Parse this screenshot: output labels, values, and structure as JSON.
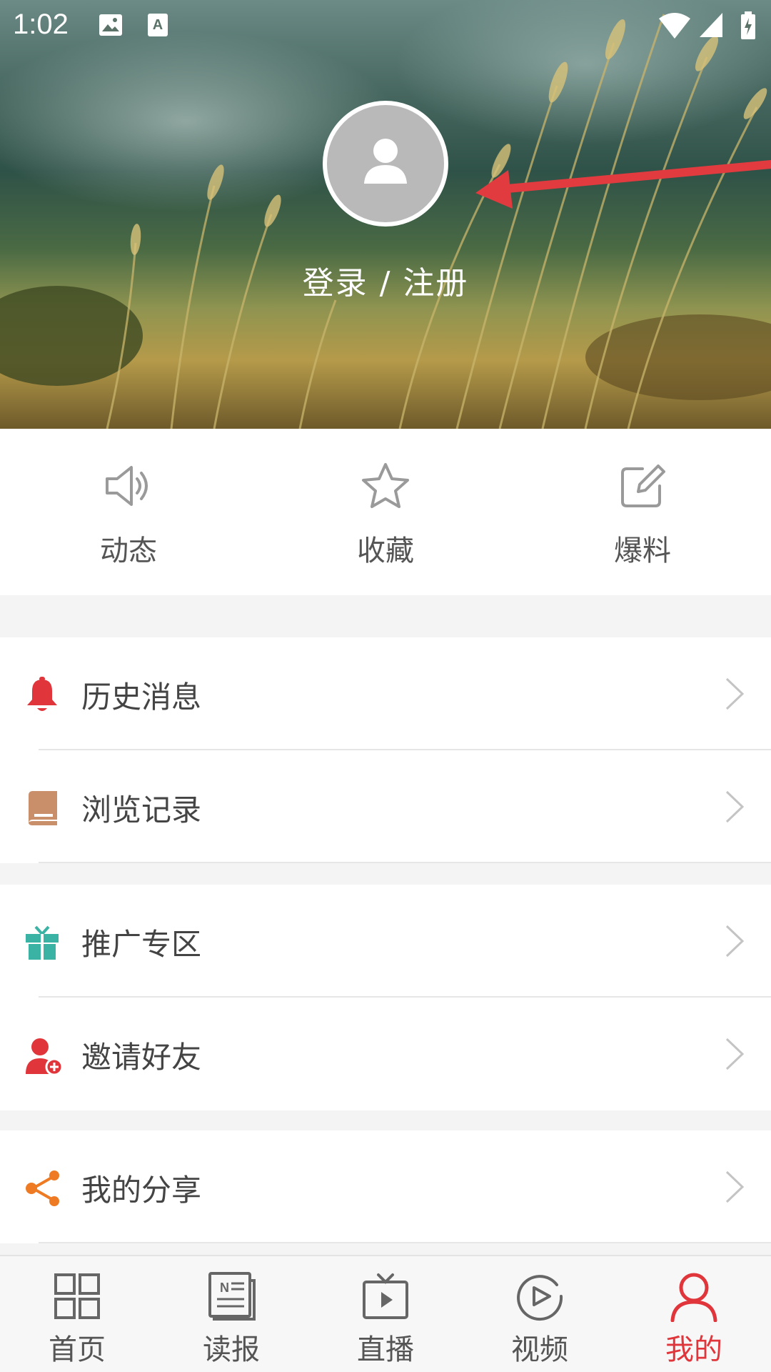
{
  "status_bar": {
    "time": "1:02"
  },
  "header": {
    "login_label": "登录 / 注册",
    "avatar_icon": "user-silhouette-icon"
  },
  "quick_actions": [
    {
      "label": "动态",
      "icon": "speaker-icon"
    },
    {
      "label": "收藏",
      "icon": "star-icon"
    },
    {
      "label": "爆料",
      "icon": "edit-icon"
    }
  ],
  "menu": {
    "history_messages": {
      "label": "历史消息",
      "icon": "bell-icon",
      "color": "#e0353b"
    },
    "browse_history": {
      "label": "浏览记录",
      "icon": "book-icon",
      "color": "#c98f6b"
    },
    "promotion_zone": {
      "label": "推广专区",
      "icon": "gift-icon",
      "color": "#3bb3a4"
    },
    "invite_friends": {
      "label": "邀请好友",
      "icon": "add-user-icon",
      "color": "#e0353b"
    },
    "my_share": {
      "label": "我的分享",
      "icon": "share-icon",
      "color": "#ee7b23"
    }
  },
  "bottom_nav": [
    {
      "label": "首页",
      "icon": "grid-icon"
    },
    {
      "label": "读报",
      "icon": "newspaper-icon"
    },
    {
      "label": "直播",
      "icon": "tv-icon"
    },
    {
      "label": "视频",
      "icon": "play-circle-icon"
    },
    {
      "label": "我的",
      "icon": "person-icon",
      "active": true
    }
  ],
  "colors": {
    "accent": "#e0353b",
    "annotation_arrow": "#e23b3f"
  }
}
